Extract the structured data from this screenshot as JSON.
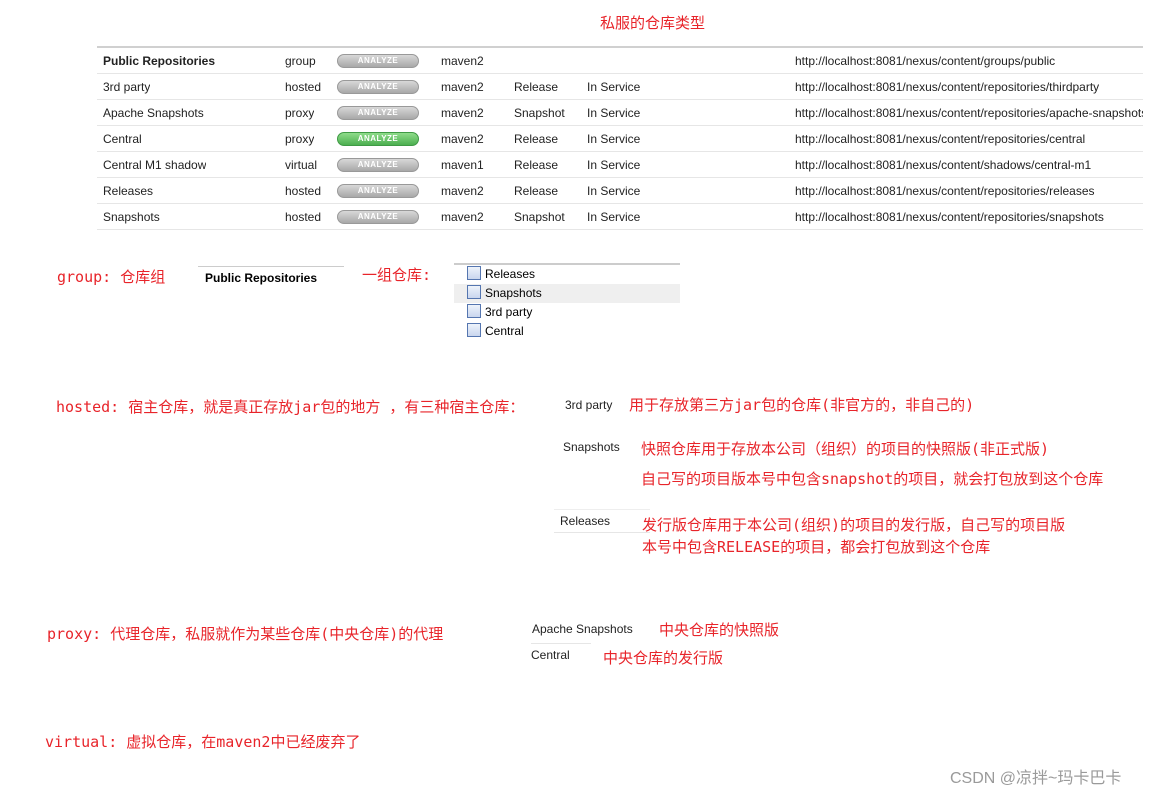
{
  "title": "私服的仓库类型",
  "table": {
    "rows": [
      {
        "name": "Public Repositories",
        "type": "group",
        "button": "ANALYZE",
        "active": false,
        "format": "maven2",
        "policy": "",
        "status": "",
        "url": "http://localhost:8081/nexus/content/groups/public"
      },
      {
        "name": "3rd party",
        "type": "hosted",
        "button": "ANALYZE",
        "active": false,
        "format": "maven2",
        "policy": "Release",
        "status": "In Service",
        "url": "http://localhost:8081/nexus/content/repositories/thirdparty"
      },
      {
        "name": "Apache Snapshots",
        "type": "proxy",
        "button": "ANALYZE",
        "active": false,
        "format": "maven2",
        "policy": "Snapshot",
        "status": "In Service",
        "url": "http://localhost:8081/nexus/content/repositories/apache-snapshots"
      },
      {
        "name": "Central",
        "type": "proxy",
        "button": "ANALYZE",
        "active": true,
        "format": "maven2",
        "policy": "Release",
        "status": "In Service",
        "url": "http://localhost:8081/nexus/content/repositories/central"
      },
      {
        "name": "Central M1 shadow",
        "type": "virtual",
        "button": "ANALYZE",
        "active": false,
        "format": "maven1",
        "policy": "Release",
        "status": "In Service",
        "url": "http://localhost:8081/nexus/content/shadows/central-m1"
      },
      {
        "name": "Releases",
        "type": "hosted",
        "button": "ANALYZE",
        "active": false,
        "format": "maven2",
        "policy": "Release",
        "status": "In Service",
        "url": "http://localhost:8081/nexus/content/repositories/releases"
      },
      {
        "name": "Snapshots",
        "type": "hosted",
        "button": "ANALYZE",
        "active": false,
        "format": "maven2",
        "policy": "Snapshot",
        "status": "In Service",
        "url": "http://localhost:8081/nexus/content/repositories/snapshots"
      }
    ]
  },
  "group": {
    "label": "group: 仓库组",
    "repo": "Public Repositories",
    "members_label": "一组仓库:",
    "members": [
      "Releases",
      "Snapshots",
      "3rd party",
      "Central"
    ]
  },
  "hosted": {
    "label": "hosted: 宿主仓库，就是真正存放jar包的地方 ，有三种宿主仓库：",
    "thirdparty": "3rd party",
    "thirdparty_desc": "用于存放第三方jar包的仓库(非官方的，非自己的)",
    "snapshots": "Snapshots",
    "snapshots_desc1": "快照仓库用于存放本公司（组织）的项目的快照版(非正式版)",
    "snapshots_desc2": "自己写的项目版本号中包含snapshot的项目，就会打包放到这个仓库",
    "releases": "Releases",
    "releases_desc1": "发行版仓库用于本公司(组织)的项目的发行版，自己写的项目版",
    "releases_desc2": "本号中包含RELEASE的项目，都会打包放到这个仓库"
  },
  "proxy": {
    "label": "proxy: 代理仓库，私服就作为某些仓库(中央仓库)的代理",
    "apache": "Apache Snapshots",
    "apache_desc": "中央仓库的快照版",
    "central": "Central",
    "central_desc": "中央仓库的发行版"
  },
  "virtual": {
    "label": "virtual: 虚拟仓库，在maven2中已经废弃了"
  },
  "watermark": "CSDN @凉拌~玛卡巴卡"
}
